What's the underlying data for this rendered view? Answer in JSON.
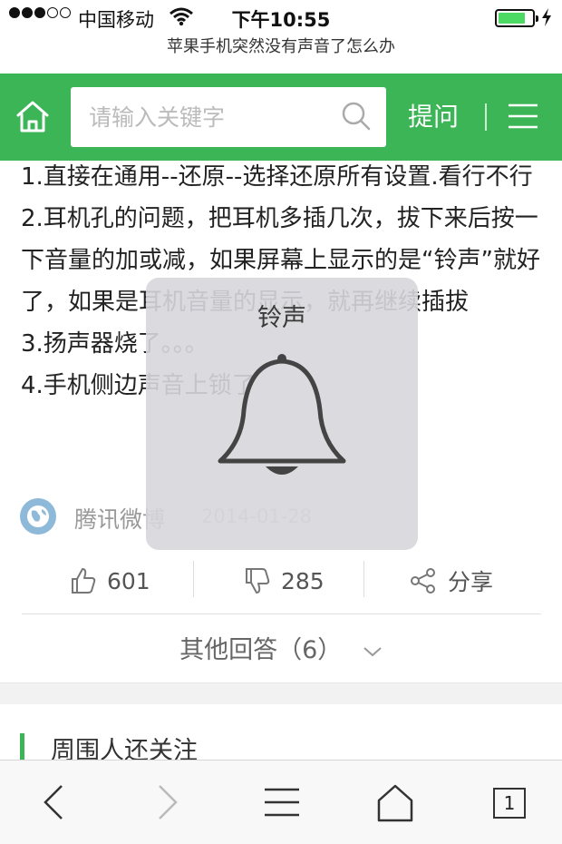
{
  "status_bar": {
    "carrier": "中国移动",
    "time": "下午10:55",
    "signal_dots_filled": 3,
    "signal_dots_total": 5,
    "battery_level": 0.8
  },
  "page_subtitle": "苹果手机突然没有声音了怎么办",
  "header": {
    "search_placeholder": "请输入关键字",
    "ask_label": "提问",
    "accent_color": "#3cb556"
  },
  "answer": {
    "lines": [
      "1.直接在通用--还原--选择还原所有设置.看行不行",
      "2.耳机孔的问题，把耳机多插几次，拔下来后按一下音量的加或减，如果屏幕上显示的是“铃声”就好了，如果是耳机音量的显示，就再继续插拔",
      "3.扬声器烧了。。。",
      "4.手机侧边声音上锁了"
    ],
    "source_name": "腾讯微博",
    "source_date": "2014-01-28"
  },
  "actions": {
    "like_count": "601",
    "dislike_count": "285",
    "share_label": "分享"
  },
  "other_answers_label": "其他回答（6）",
  "related_title": "周围人还关注",
  "toolbar": {
    "tab_count": "1"
  },
  "hud": {
    "label": "铃声",
    "icon": "bell-icon"
  }
}
